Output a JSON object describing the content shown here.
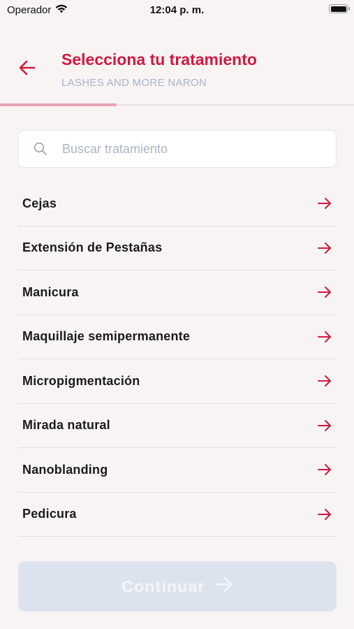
{
  "status_bar": {
    "carrier": "Operador",
    "time": "12:04 p. m."
  },
  "header": {
    "title": "Selecciona tu tratamiento",
    "subtitle": "LASHES AND MORE NARON",
    "back_icon": "arrow-left-icon"
  },
  "progress": {
    "fraction": 0.33
  },
  "search": {
    "placeholder": "Buscar tratamiento",
    "value": ""
  },
  "treatments": [
    {
      "label": "Cejas"
    },
    {
      "label": "Extensión de Pestañas"
    },
    {
      "label": "Manicura"
    },
    {
      "label": "Maquillaje semipermanente"
    },
    {
      "label": "Micropigmentación"
    },
    {
      "label": "Mirada natural"
    },
    {
      "label": "Nanoblanding"
    },
    {
      "label": "Pedicura"
    }
  ],
  "continue_button": {
    "label": "Continuar",
    "disabled": true
  },
  "colors": {
    "accent": "#d0193f",
    "subtitle": "#a5b3cb",
    "background": "#f8f4f4",
    "button_disabled": "#dde3ee",
    "progress": "#e8a4b2"
  }
}
